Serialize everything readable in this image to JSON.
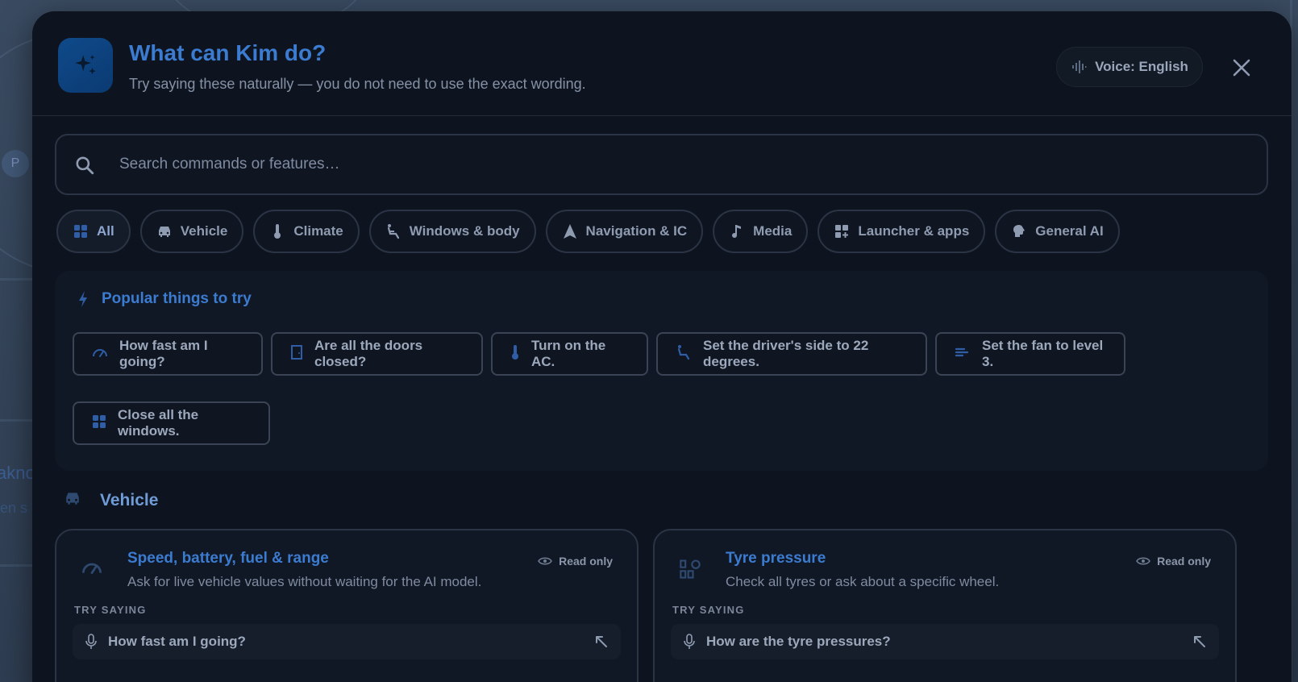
{
  "header": {
    "title": "What can Kim do?",
    "subtitle": "Try saying these naturally — you do not need to use the exact wording.",
    "voice_label": "Voice: English"
  },
  "search": {
    "placeholder": "Search commands or features…"
  },
  "filters": [
    {
      "label": "All",
      "icon": "grid-icon",
      "active": true
    },
    {
      "label": "Vehicle",
      "icon": "car-icon"
    },
    {
      "label": "Climate",
      "icon": "thermometer-icon"
    },
    {
      "label": "Windows & body",
      "icon": "seat-icon"
    },
    {
      "label": "Navigation & IC",
      "icon": "navigation-arrow-icon"
    },
    {
      "label": "Media",
      "icon": "music-note-icon"
    },
    {
      "label": "Launcher & apps",
      "icon": "apps-icon"
    },
    {
      "label": "General AI",
      "icon": "brain-icon"
    }
  ],
  "popular": {
    "title": "Popular things to try",
    "items": [
      {
        "label": "How fast am I going?",
        "icon": "speedometer-icon"
      },
      {
        "label": "Are all the doors closed?",
        "icon": "door-icon"
      },
      {
        "label": "Turn on the AC.",
        "icon": "thermometer-icon"
      },
      {
        "label": "Set the driver's side to 22 degrees.",
        "icon": "seat-icon"
      },
      {
        "label": "Set the fan to level 3.",
        "icon": "fan-icon"
      },
      {
        "label": "Close all the windows.",
        "icon": "grid-icon"
      }
    ]
  },
  "section": {
    "title": "Vehicle",
    "icon": "car-icon"
  },
  "cards": [
    {
      "title": "Speed, battery, fuel & range",
      "description": "Ask for live vehicle values without waiting for the AI model.",
      "badge": "Read only",
      "try_label": "TRY SAYING",
      "example": "How fast am I going?",
      "icon": "speedometer-icon"
    },
    {
      "title": "Tyre pressure",
      "description": "Check all tyres or ask about a specific wheel.",
      "badge": "Read only",
      "try_label": "TRY SAYING",
      "example": "How are the tyre pressures?",
      "icon": "tyre-icon"
    }
  ],
  "background": {
    "pin_label": "P",
    "text_1": "akno",
    "text_2": "en s"
  },
  "colors": {
    "accent": "#3b7bd0",
    "modal_bg": "#0e141f",
    "border": "#2a3444"
  }
}
